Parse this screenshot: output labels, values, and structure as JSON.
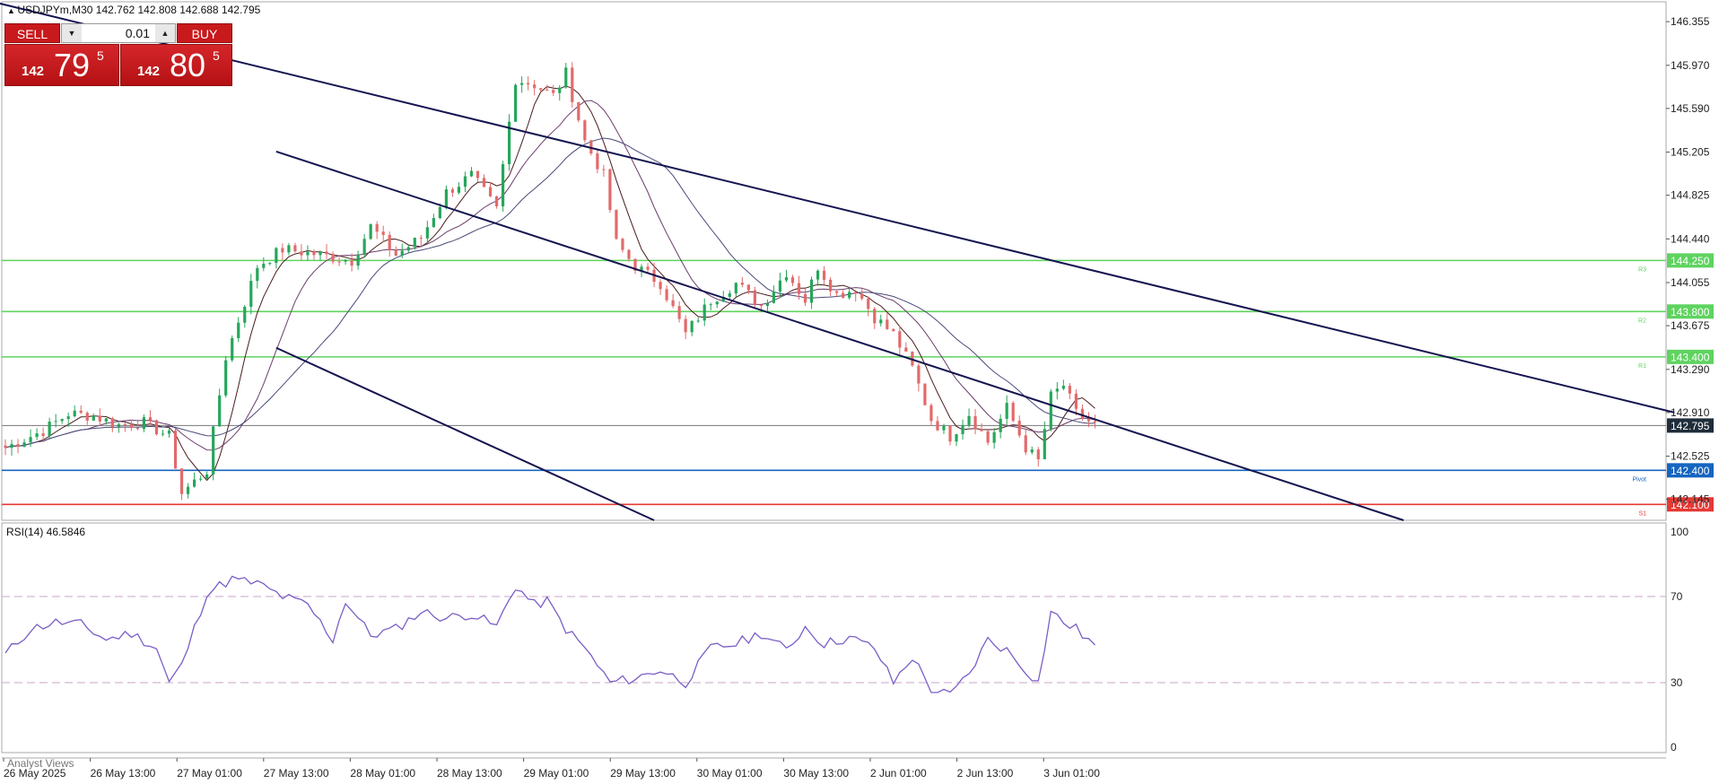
{
  "header": {
    "symbol_line": "USDJPYm,M30",
    "ohlc": "142.762 142.808 142.688 142.795"
  },
  "trade_panel": {
    "sell_label": "SELL",
    "buy_label": "BUY",
    "lot": "0.01",
    "sell_big": "142",
    "sell_mid": "79",
    "sell_small": "5",
    "buy_big": "142",
    "buy_mid": "80",
    "buy_small": "5"
  },
  "colors": {
    "bull": "#26a65b",
    "bear": "#e26a6a",
    "channel": "#141450",
    "level": "#5fd35f",
    "pivot": "#1565c0",
    "s1": "#e53935",
    "ma1": "#4a1c1c",
    "ma2": "#6c3d6c",
    "ma3": "#4a4a7a",
    "rsi": "#7b5ec6"
  },
  "rsi_panel": {
    "title": "RSI(14) 46.5846",
    "scale": [
      "100",
      "70",
      "30",
      "0"
    ]
  },
  "bottom_tab": "Analyst Views",
  "chart_data": {
    "type": "candlestick",
    "symbol": "USDJPYm",
    "timeframe": "M30",
    "ylim": [
      141.96,
      146.53
    ],
    "y_ticks": [
      "146.355",
      "145.970",
      "145.590",
      "145.205",
      "144.825",
      "144.440",
      "144.055",
      "143.675",
      "143.290",
      "142.910",
      "142.525",
      "142.145"
    ],
    "x_ticks": [
      "26 May 2025",
      "26 May 13:00",
      "27 May 01:00",
      "27 May 13:00",
      "28 May 01:00",
      "28 May 13:00",
      "29 May 01:00",
      "29 May 13:00",
      "30 May 01:00",
      "30 May 13:00",
      "2 Jun 01:00",
      "2 Jun 13:00",
      "3 Jun 01:00"
    ],
    "current_price": "142.795",
    "levels": [
      {
        "price": 144.25,
        "label": "144.250",
        "tag": "R3",
        "color": "#5fd35f",
        "line": "#5fd35f",
        "text": "#ffffff"
      },
      {
        "price": 143.8,
        "label": "143.800",
        "tag": "R2",
        "color": "#5fd35f",
        "line": "#5fd35f",
        "text": "#ffffff"
      },
      {
        "price": 143.4,
        "label": "143.400",
        "tag": "R1",
        "color": "#5fd35f",
        "line": "#5fd35f",
        "text": "#ffffff"
      },
      {
        "price": 142.4,
        "label": "142.400",
        "tag": "Pivot",
        "color": "#1565c0",
        "line": "#1565c0",
        "text": "#ffffff"
      },
      {
        "price": 142.1,
        "label": "142.100",
        "tag": "S1",
        "color": "#e53935",
        "line": "#e53935",
        "text": "#ffffff"
      },
      {
        "price": 142.795,
        "label": "142.795",
        "tag": "",
        "color": "#1f2d3a",
        "line": "#777777",
        "text": "#ffffff"
      }
    ],
    "channel_lines": [
      {
        "from": {
          "bar": -2,
          "price": 146.53
        },
        "to": {
          "bar": 265,
          "price": 142.91
        }
      },
      {
        "from": {
          "bar": 43,
          "price": 145.21
        },
        "to": {
          "bar": 222,
          "price": 141.96
        }
      },
      {
        "from": {
          "bar": 43,
          "price": 143.48
        },
        "to": {
          "bar": 103,
          "price": 141.96
        }
      }
    ],
    "anchors": [
      [
        0,
        142.6
      ],
      [
        6,
        142.75
      ],
      [
        10,
        142.9
      ],
      [
        14,
        142.88
      ],
      [
        18,
        142.8
      ],
      [
        22,
        142.82
      ],
      [
        26,
        142.7
      ],
      [
        28,
        142.2
      ],
      [
        32,
        142.4
      ],
      [
        35,
        143.4
      ],
      [
        40,
        144.2
      ],
      [
        44,
        144.35
      ],
      [
        50,
        144.3
      ],
      [
        55,
        144.25
      ],
      [
        58,
        144.55
      ],
      [
        62,
        144.3
      ],
      [
        66,
        144.45
      ],
      [
        70,
        144.85
      ],
      [
        74,
        145.0
      ],
      [
        78,
        144.7
      ],
      [
        81,
        145.85
      ],
      [
        84,
        145.8
      ],
      [
        87,
        145.7
      ],
      [
        89,
        145.9
      ],
      [
        92,
        145.3
      ],
      [
        95,
        145.0
      ],
      [
        97,
        144.4
      ],
      [
        100,
        144.2
      ],
      [
        104,
        144.05
      ],
      [
        108,
        143.6
      ],
      [
        112,
        143.9
      ],
      [
        116,
        144.05
      ],
      [
        120,
        143.85
      ],
      [
        124,
        144.15
      ],
      [
        127,
        143.9
      ],
      [
        129,
        144.2
      ],
      [
        132,
        143.95
      ],
      [
        135,
        144.0
      ],
      [
        138,
        143.75
      ],
      [
        141,
        143.6
      ],
      [
        144,
        143.3
      ],
      [
        147,
        142.85
      ],
      [
        150,
        142.7
      ],
      [
        153,
        142.9
      ],
      [
        156,
        142.65
      ],
      [
        159,
        142.95
      ],
      [
        162,
        142.6
      ],
      [
        164,
        142.48
      ],
      [
        166,
        143.05
      ],
      [
        168,
        143.15
      ],
      [
        170,
        142.9
      ],
      [
        173,
        142.8
      ]
    ],
    "volatility": 0.055,
    "moving_averages": [
      {
        "period": 20,
        "color": "#4a1c1c"
      },
      {
        "period": 50,
        "color": "#6c3d6c"
      },
      {
        "period": 100,
        "color": "#4a4a7a"
      }
    ],
    "rsi": {
      "period": 14,
      "value": 46.5846,
      "levels": [
        70,
        30
      ],
      "ylim": [
        0,
        100
      ],
      "anchors": [
        [
          0,
          43
        ],
        [
          4,
          55
        ],
        [
          8,
          58
        ],
        [
          12,
          57
        ],
        [
          16,
          50
        ],
        [
          20,
          53
        ],
        [
          24,
          46
        ],
        [
          26,
          30
        ],
        [
          28,
          38
        ],
        [
          32,
          72
        ],
        [
          36,
          78
        ],
        [
          40,
          76
        ],
        [
          44,
          70
        ],
        [
          48,
          66
        ],
        [
          52,
          50
        ],
        [
          54,
          68
        ],
        [
          58,
          52
        ],
        [
          62,
          55
        ],
        [
          66,
          63
        ],
        [
          70,
          60
        ],
        [
          74,
          62
        ],
        [
          78,
          56
        ],
        [
          81,
          75
        ],
        [
          84,
          66
        ],
        [
          86,
          68
        ],
        [
          89,
          55
        ],
        [
          92,
          46
        ],
        [
          96,
          30
        ],
        [
          100,
          32
        ],
        [
          104,
          36
        ],
        [
          108,
          30
        ],
        [
          112,
          46
        ],
        [
          116,
          48
        ],
        [
          120,
          53
        ],
        [
          124,
          45
        ],
        [
          127,
          56
        ],
        [
          130,
          48
        ],
        [
          134,
          51
        ],
        [
          138,
          46
        ],
        [
          141,
          30
        ],
        [
          144,
          42
        ],
        [
          147,
          27
        ],
        [
          150,
          24
        ],
        [
          153,
          34
        ],
        [
          156,
          50
        ],
        [
          159,
          45
        ],
        [
          162,
          36
        ],
        [
          164,
          30
        ],
        [
          166,
          63
        ],
        [
          168,
          58
        ],
        [
          170,
          55
        ],
        [
          173,
          47
        ]
      ]
    }
  }
}
